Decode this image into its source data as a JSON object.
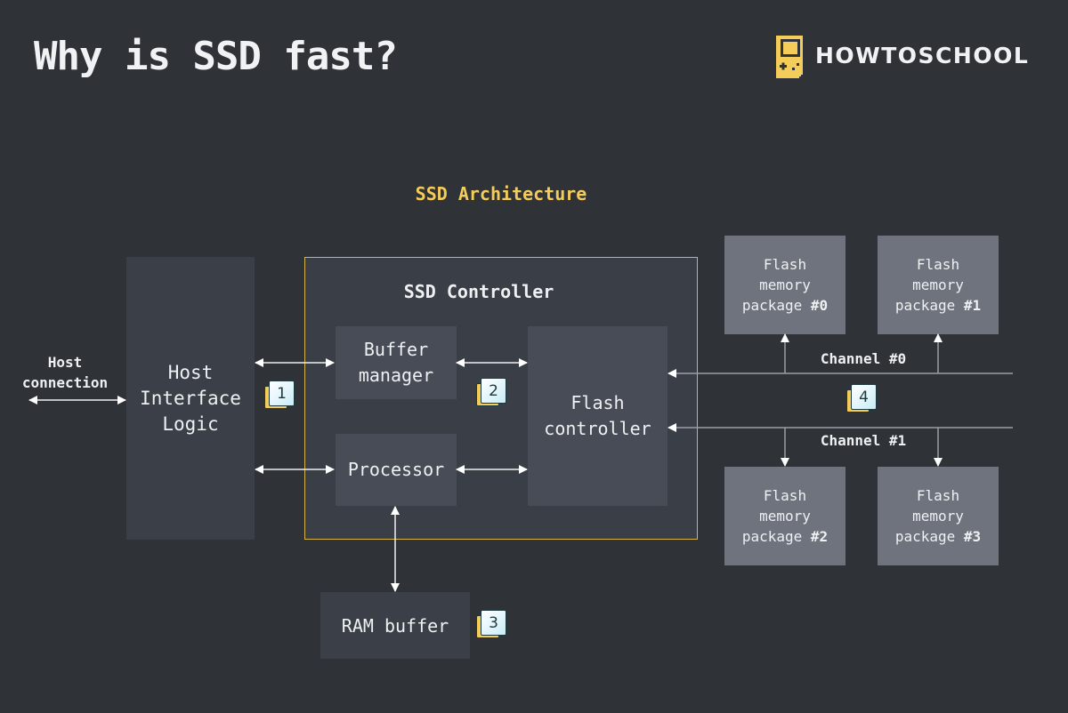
{
  "header": {
    "title": "Why is SSD fast?",
    "logo_text": "HOWTOSCHOOL",
    "logo_icon": "gameboy-icon"
  },
  "diagram": {
    "title": "SSD Architecture",
    "host_connection_label": "Host\nconnection",
    "host_interface": "Host\nInterface\nLogic",
    "controller": {
      "title": "SSD Controller",
      "buffer_manager": "Buffer\nmanager",
      "processor": "Processor",
      "flash_controller": "Flash\ncontroller"
    },
    "ram_buffer": "RAM buffer",
    "channels": [
      "Channel #0",
      "Channel #1"
    ],
    "packages": [
      {
        "line1": "Flash",
        "line2": "memory",
        "line3": "package ",
        "num": "#0"
      },
      {
        "line1": "Flash",
        "line2": "memory",
        "line3": "package ",
        "num": "#1"
      },
      {
        "line1": "Flash",
        "line2": "memory",
        "line3": "package ",
        "num": "#2"
      },
      {
        "line1": "Flash",
        "line2": "memory",
        "line3": "package ",
        "num": "#3"
      }
    ],
    "badges": [
      "1",
      "2",
      "3",
      "4"
    ]
  },
  "colors": {
    "background": "#2f3337",
    "accent": "#f4cc5a",
    "controller_border": "#d9b547",
    "package_fill": "#6f737e"
  }
}
